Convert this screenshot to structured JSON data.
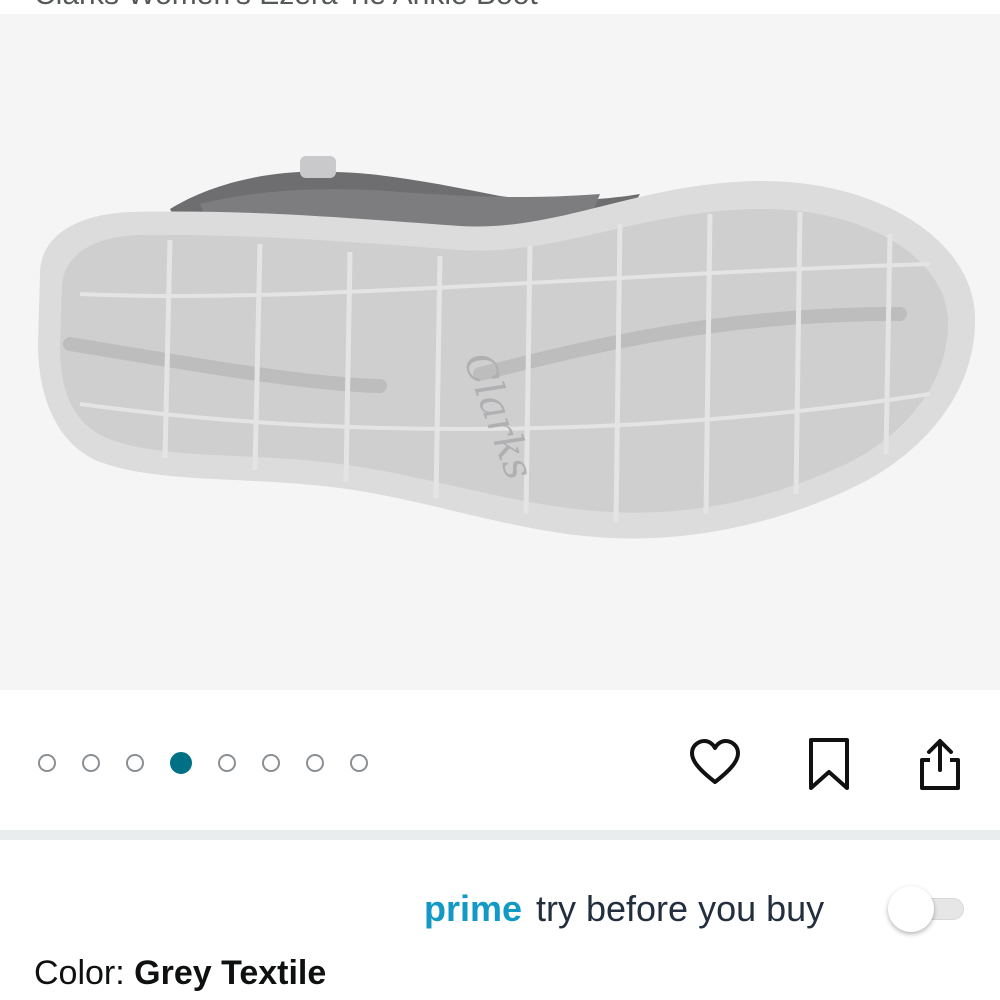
{
  "product": {
    "title": "Clarks Women's Ezera Tie Ankle Boot"
  },
  "image": {
    "sole_brand_text": "Clarks"
  },
  "carousel": {
    "count": 8,
    "active_index": 3
  },
  "actions": {
    "wishlist_icon": "heart-icon",
    "save_icon": "bookmark-icon",
    "share_icon": "share-icon"
  },
  "prime": {
    "word": "prime",
    "label": "try before you buy",
    "toggle_on": false
  },
  "variation": {
    "label": "Color: ",
    "value": "Grey Textile"
  },
  "colors": {
    "accent": "#007185",
    "prime_blue": "#1399c6",
    "text_dark": "#232f3e"
  }
}
